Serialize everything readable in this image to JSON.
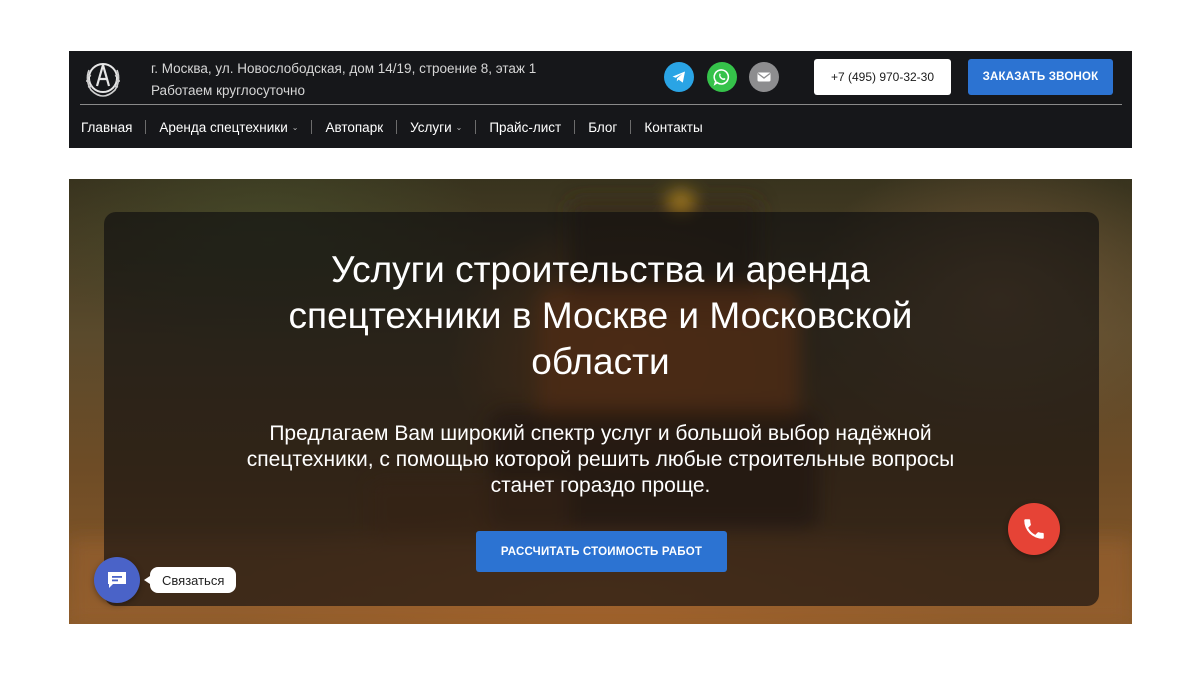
{
  "header": {
    "logo_icon": "wreath-emblem-icon",
    "address_line": "г. Москва, ул. Новослободская, дом 14/19, строение 8, этаж 1",
    "hours_line": "Работаем круглосуточно",
    "social": [
      {
        "name": "telegram-icon",
        "color": "#2aa4e5"
      },
      {
        "name": "whatsapp-icon",
        "color": "#35c24a"
      },
      {
        "name": "email-icon",
        "color": "#8d8d8f"
      }
    ],
    "phone_label": "+7 (495) 970-32-30",
    "callback_label": "ЗАКАЗАТЬ ЗВОНОК",
    "accent_color": "#2c73d2"
  },
  "nav": {
    "items": [
      {
        "label": "Главная",
        "has_dropdown": false
      },
      {
        "label": "Аренда спецтехники",
        "has_dropdown": true
      },
      {
        "label": "Автопарк",
        "has_dropdown": false
      },
      {
        "label": "Услуги",
        "has_dropdown": true
      },
      {
        "label": "Прайс-лист",
        "has_dropdown": false
      },
      {
        "label": "Блог",
        "has_dropdown": false
      },
      {
        "label": "Контакты",
        "has_dropdown": false
      }
    ]
  },
  "hero": {
    "title_lines": [
      "Услуги строительства и аренда",
      "спецтехники в Москве и Московской",
      "области"
    ],
    "subtitle_lines": [
      "Предлагаем Вам широкий спектр услуг и большой выбор надёжной",
      "спецтехники, с помощью которой решить любые строительные вопросы",
      "станет гораздо проще."
    ],
    "cta_label": "РАССЧИТАТЬ СТОИМОСТЬ РАБОТ"
  },
  "widgets": {
    "chat_label": "Связаться",
    "chat_color": "#4a63c8",
    "phone_color": "#e64336"
  }
}
